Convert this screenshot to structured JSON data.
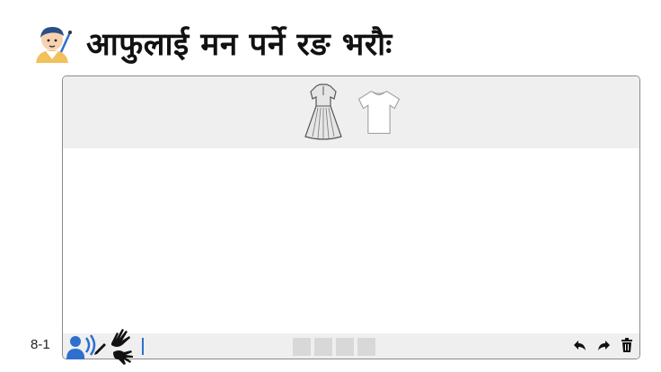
{
  "header": {
    "title": "आफुलाई मन पर्ने रङ भरौः"
  },
  "palette": {
    "items": [
      {
        "icon": "dress-icon"
      },
      {
        "icon": "tshirt-icon"
      }
    ]
  },
  "footer": {
    "page_label": "8-1"
  },
  "toolbar": {
    "swatch_count": 4,
    "tools": [
      "undo-icon",
      "redo-icon",
      "trash-icon"
    ]
  },
  "colors": {
    "palette_bg": "#efefef",
    "accent_blue": "#2e6fcf",
    "swatch": "#d8d8d8"
  }
}
